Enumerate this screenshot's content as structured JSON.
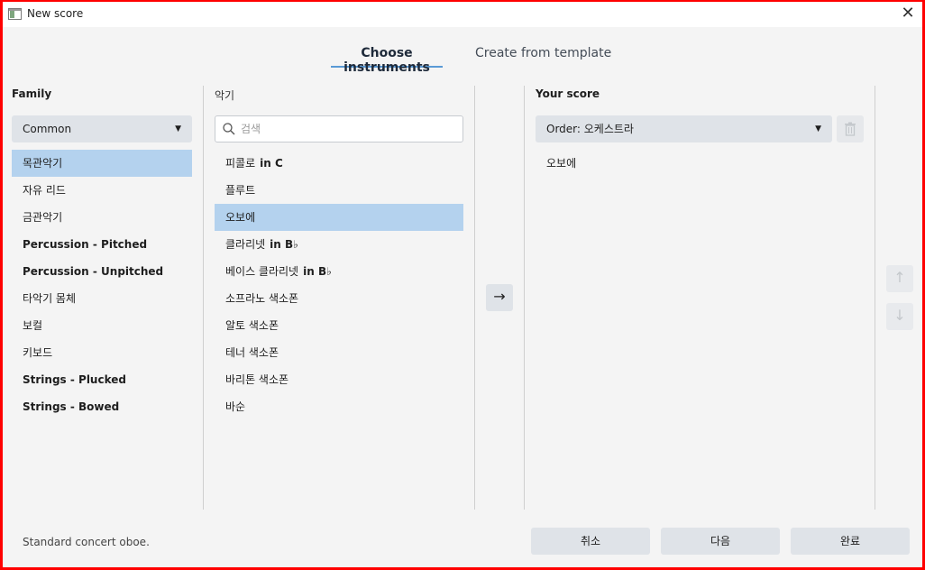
{
  "window": {
    "title": "New score",
    "close_glyph": "✕"
  },
  "tabs": [
    {
      "label": "Choose instruments",
      "active": true
    },
    {
      "label": "Create from template",
      "active": false
    }
  ],
  "family": {
    "heading": "Family",
    "dropdown_value": "Common",
    "items": [
      {
        "label": "목관악기",
        "bold": false,
        "selected": true
      },
      {
        "label": "자유 리드",
        "bold": false,
        "selected": false
      },
      {
        "label": "금관악기",
        "bold": false,
        "selected": false
      },
      {
        "label": "Percussion - Pitched",
        "bold": true,
        "selected": false
      },
      {
        "label": "Percussion - Unpitched",
        "bold": true,
        "selected": false
      },
      {
        "label": "타악기 몸체",
        "bold": false,
        "selected": false
      },
      {
        "label": "보컬",
        "bold": false,
        "selected": false
      },
      {
        "label": "키보드",
        "bold": false,
        "selected": false
      },
      {
        "label": "Strings - Plucked",
        "bold": true,
        "selected": false
      },
      {
        "label": "Strings - Bowed",
        "bold": true,
        "selected": false
      }
    ]
  },
  "instruments": {
    "heading": "악기",
    "search_placeholder": "검색",
    "items": [
      {
        "label": "피콜로",
        "suffix": "in C",
        "selected": false
      },
      {
        "label": "플루트",
        "suffix": "",
        "selected": false
      },
      {
        "label": "오보에",
        "suffix": "",
        "selected": true
      },
      {
        "label": "클라리넷",
        "suffix": "in B♭",
        "selected": false
      },
      {
        "label": "베이스 클라리넷",
        "suffix": "in B♭",
        "selected": false
      },
      {
        "label": "소프라노 색소폰",
        "suffix": "",
        "selected": false
      },
      {
        "label": "알토 색소폰",
        "suffix": "",
        "selected": false
      },
      {
        "label": "테너 색소폰",
        "suffix": "",
        "selected": false
      },
      {
        "label": "바리톤 색소폰",
        "suffix": "",
        "selected": false
      },
      {
        "label": "바순",
        "suffix": "",
        "selected": false
      }
    ]
  },
  "add_button": {
    "glyph": "→"
  },
  "score": {
    "heading": "Your score",
    "order_value": "Order: 오케스트라",
    "items": [
      {
        "label": "오보에"
      }
    ],
    "up_glyph": "↑",
    "down_glyph": "↓"
  },
  "status": "Standard concert oboe.",
  "footer": {
    "cancel": "취소",
    "next": "다음",
    "done": "완료"
  },
  "colors": {
    "selection": "#b4d2ee",
    "tab_underline": "#5a9ad6",
    "button_bg": "#dfe3e8"
  }
}
